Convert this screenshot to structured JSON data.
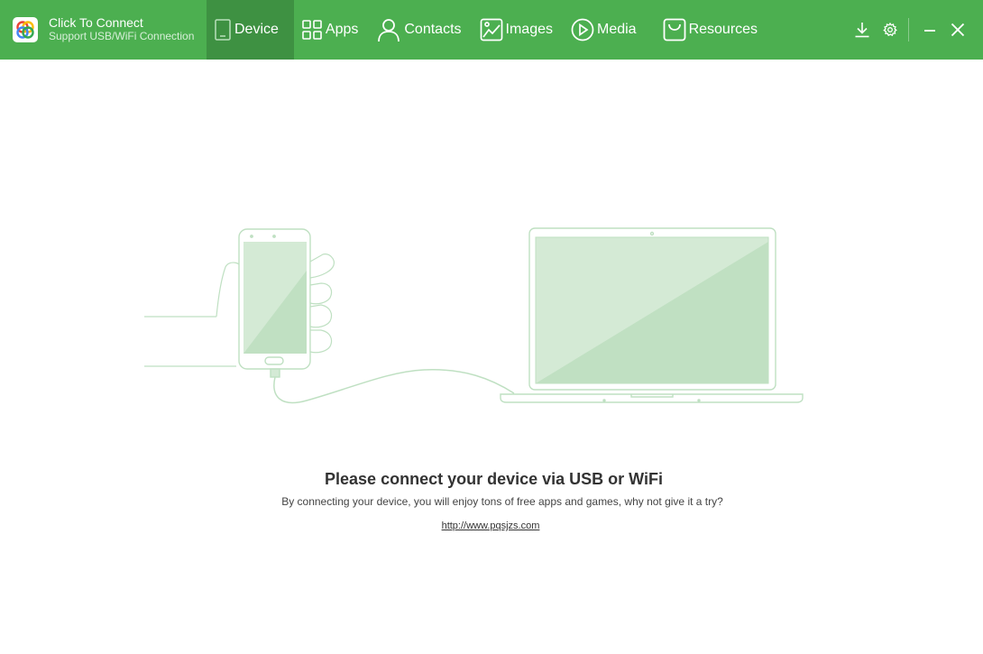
{
  "app": {
    "title": "Click To Connect",
    "subtitle": "Support USB/WiFi Connection",
    "logo_icon": "connect-logo-icon"
  },
  "tabs": [
    {
      "label": "Device",
      "icon": "phone-icon",
      "active": true
    },
    {
      "label": "Apps",
      "icon": "grid-icon",
      "active": false
    },
    {
      "label": "Contacts",
      "icon": "person-icon",
      "active": false
    },
    {
      "label": "Images",
      "icon": "image-icon",
      "active": false
    },
    {
      "label": "Media",
      "icon": "play-icon",
      "active": false
    },
    {
      "label": "Resources",
      "icon": "bag-icon",
      "active": false
    }
  ],
  "window_controls": [
    "download-icon",
    "gear-icon",
    "minimize-icon",
    "close-icon"
  ],
  "main": {
    "title": "Please connect your device via USB or WiFi",
    "subtitle": "By connecting your device, you will enjoy tons of free apps and games, why not give it a try?",
    "link": "http://www.pqsjzs.com"
  },
  "colors": {
    "topbar": "#4caf50",
    "active_tab": "#3e9142",
    "illustration_stroke": "#bfe0c2",
    "screen_fill": "#d4ead5"
  }
}
